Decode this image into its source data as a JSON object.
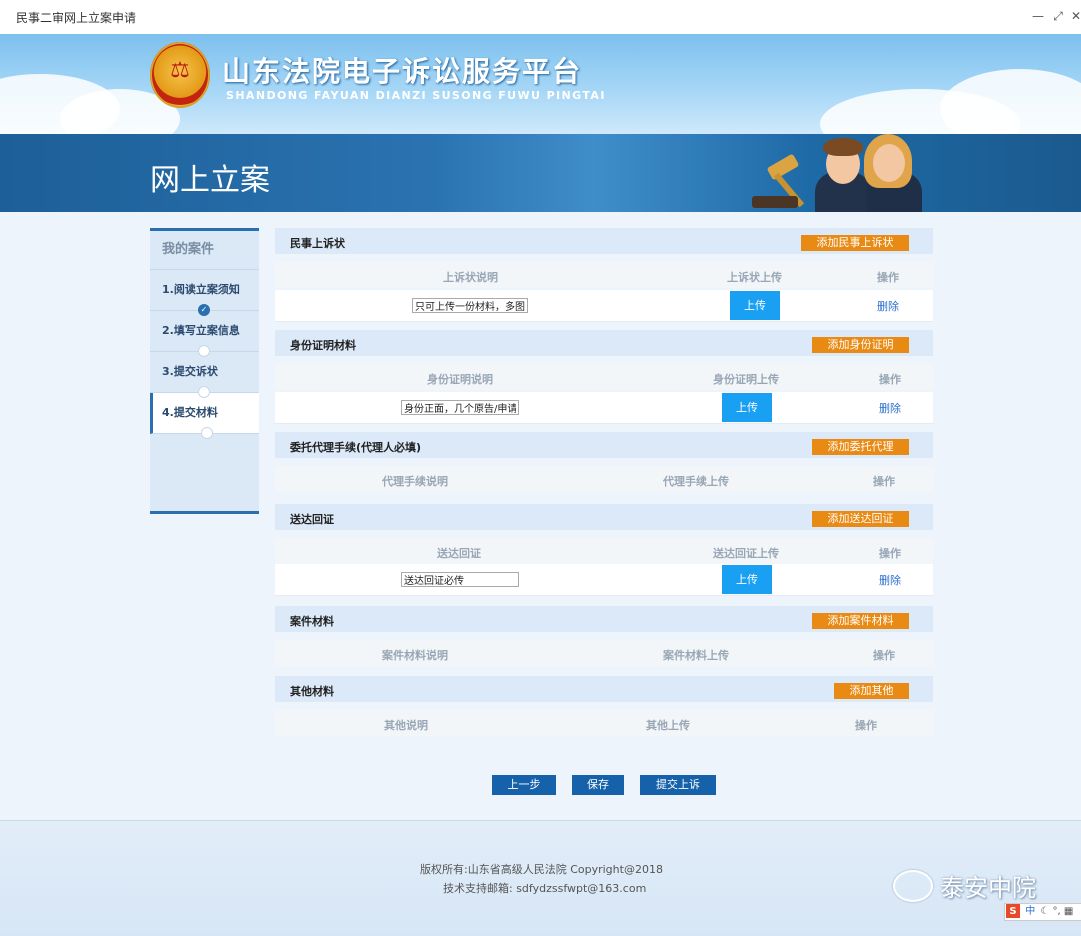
{
  "window": {
    "title": "民事二审网上立案申请",
    "minimize": "—",
    "restore": "⤢",
    "close": "✕"
  },
  "header": {
    "logo_title": "山东法院电子诉讼服务平台",
    "logo_subtitle": "SHANDONG FAYUAN DIANZI SUSONG FUWU PINGTAI",
    "emblem_glyph": "⚖",
    "page_title": "网上立案"
  },
  "sidebar": {
    "heading": "我的案件",
    "items": [
      {
        "label": "1.阅读立案须知",
        "done": true
      },
      {
        "label": "2.填写立案信息",
        "done": false
      },
      {
        "label": "3.提交诉状",
        "done": false
      },
      {
        "label": "4.提交材料",
        "done": false,
        "active": true
      }
    ]
  },
  "sections": {
    "complaint": {
      "title": "民事上诉状",
      "add": "添加民事上诉状",
      "headers": [
        "上诉状说明",
        "上诉状上传",
        "操作"
      ],
      "row": {
        "desc": "只可上传一份材料，多图,",
        "upload": "上传",
        "delete": "删除"
      }
    },
    "identity": {
      "title": "身份证明材料",
      "add": "添加身份证明",
      "headers": [
        "身份证明说明",
        "身份证明上传",
        "操作"
      ],
      "row": {
        "desc": "身份正面，几个原告/申请",
        "upload": "上传",
        "delete": "删除"
      }
    },
    "agent": {
      "title": "委托代理手续(代理人必填)",
      "add": "添加委托代理",
      "headers": [
        "代理手续说明",
        "代理手续上传",
        "操作"
      ]
    },
    "service": {
      "title": "送达回证",
      "add": "添加送达回证",
      "headers": [
        "送达回证",
        "送达回证上传",
        "操作"
      ],
      "row": {
        "desc": "送达回证必传",
        "upload": "上传",
        "delete": "删除"
      }
    },
    "case": {
      "title": "案件材料",
      "add": "添加案件材料",
      "headers": [
        "案件材料说明",
        "案件材料上传",
        "操作"
      ]
    },
    "other": {
      "title": "其他材料",
      "add": "添加其他",
      "headers": [
        "其他说明",
        "其他上传",
        "操作"
      ]
    }
  },
  "actions": {
    "prev": "上一步",
    "save": "保存",
    "submit": "提交上诉"
  },
  "footer": {
    "copyright": "版权所有:山东省高级人民法院 Copyright@2018",
    "support": "技术支持邮箱:  sdfydzssfwpt@163.com"
  },
  "watermark": "泰安中院",
  "tray": {
    "ime": "S",
    "lang": "中"
  },
  "colors": {
    "accent_blue": "#1561aa",
    "upload_blue": "#1aa0f2",
    "orange": "#e88a13",
    "section_bg": "#dce9f8"
  }
}
